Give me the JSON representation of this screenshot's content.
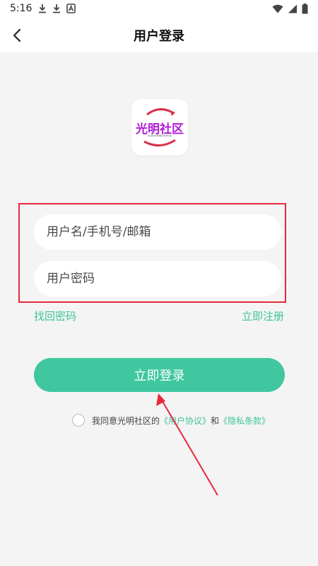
{
  "status_bar": {
    "time": "5:16",
    "left_icons": [
      "download-icon",
      "download-icon",
      "app-notification-icon"
    ],
    "right_icons": [
      "wifi-icon",
      "signal-icon",
      "battery-icon"
    ]
  },
  "header": {
    "back_icon": "chevron-left-icon",
    "title": "用户登录"
  },
  "logo": {
    "text": "光明社区",
    "subtext": "GUANGMINGSHEQU"
  },
  "form": {
    "username_placeholder": "用户名/手机号/邮箱",
    "password_placeholder": "用户密码",
    "forgot_label": "找回密码",
    "register_label": "立即注册",
    "login_label": "立即登录"
  },
  "agreement": {
    "text": "我同意光明社区的",
    "user_agreement": "《用户协议》",
    "and": "和",
    "privacy_policy": "《隐私条款》"
  },
  "colors": {
    "accent": "#40c79f",
    "link": "#3fc39a",
    "annotation_red": "#e8283a",
    "logo_purple": "#b11bd6"
  }
}
